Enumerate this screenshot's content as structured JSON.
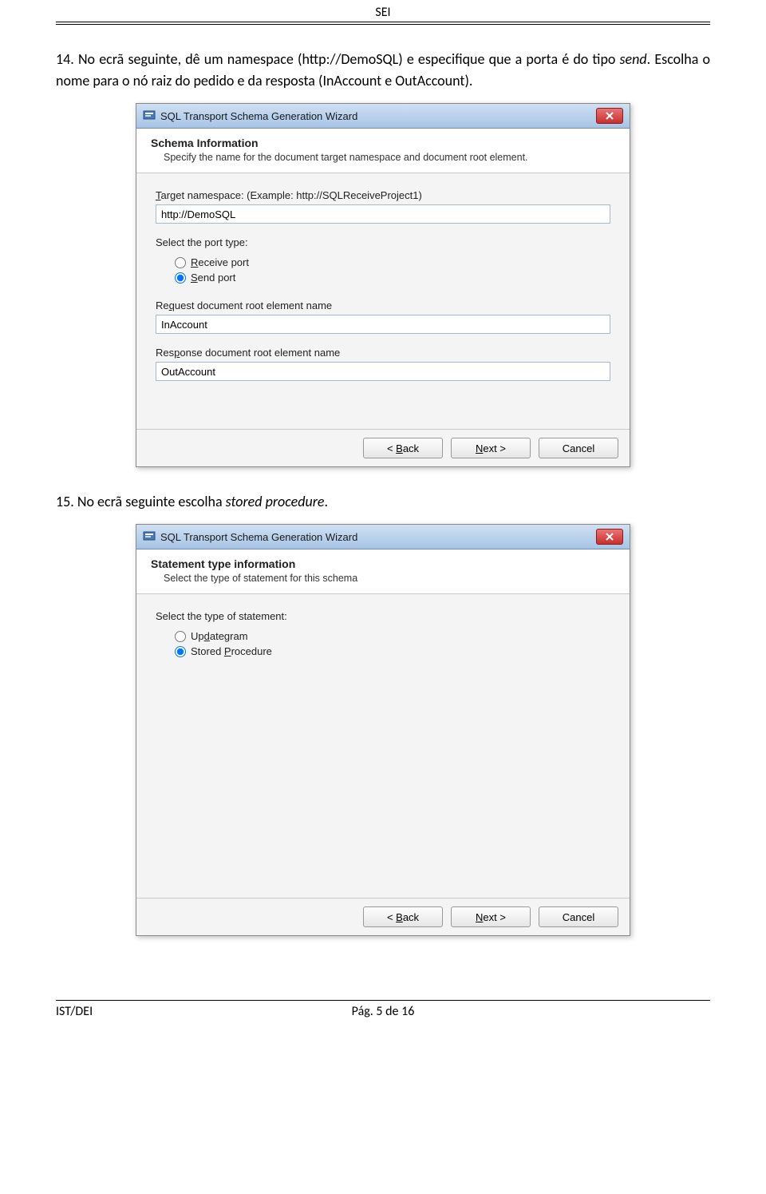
{
  "header": {
    "title": "SEI"
  },
  "paragraphs": {
    "p14_prefix": "14. No ecrã seguinte, dê um namespace (http://DemoSQL) e especifique que a porta é do tipo ",
    "p14_italic": "send",
    "p14_suffix": ". Escolha o nome para o nó raiz do pedido e da resposta (InAccount e OutAccount).",
    "p15_prefix": "15. No ecrã seguinte escolha ",
    "p15_italic": "stored procedure",
    "p15_suffix": "."
  },
  "wizard1": {
    "window_title": "SQL Transport Schema Generation Wizard",
    "header_title": "Schema Information",
    "header_sub": "Specify the name for the document target namespace and document root element.",
    "label_namespace": "Target namespace: (Example: http://SQLReceiveProject1)",
    "value_namespace": "http://DemoSQL",
    "label_porttype": "Select the port type:",
    "radio_receive": "Receive port",
    "radio_send": "Send port",
    "label_request": "Request document root element name",
    "value_request": "InAccount",
    "label_response": "Response document root element name",
    "value_response": "OutAccount",
    "btn_back": "< Back",
    "btn_next": "Next >",
    "btn_cancel": "Cancel"
  },
  "wizard2": {
    "window_title": "SQL Transport Schema Generation Wizard",
    "header_title": "Statement type information",
    "header_sub": "Select the type of statement for this schema",
    "label_stmt": "Select the type of statement:",
    "radio_updategram": "Updategram",
    "radio_sp": "Stored Procedure",
    "btn_back": "< Back",
    "btn_next": "Next >",
    "btn_cancel": "Cancel"
  },
  "footer": {
    "left": "IST/DEI",
    "center": "Pág. 5 de 16"
  }
}
